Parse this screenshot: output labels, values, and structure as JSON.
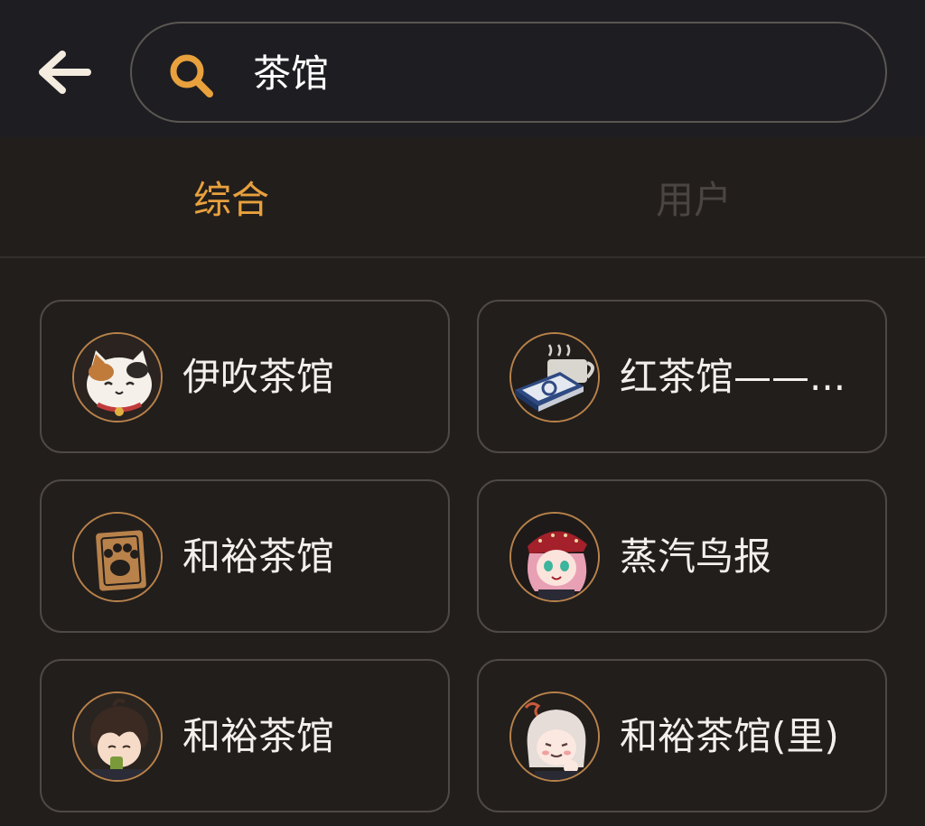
{
  "header": {
    "back_icon": "arrow-left-icon",
    "search_icon": "search-icon",
    "search_value": "茶馆",
    "accent_color": "#e8a13d"
  },
  "tabs": [
    {
      "label": "综合",
      "active": true
    },
    {
      "label": "用户",
      "active": false
    }
  ],
  "results": [
    {
      "title": "伊吹茶馆",
      "avatar": "lucky-cat-avatar"
    },
    {
      "title": "红茶馆——...",
      "avatar": "teacup-book-avatar"
    },
    {
      "title": "和裕茶馆",
      "avatar": "paw-card-avatar"
    },
    {
      "title": "蒸汽鸟报",
      "avatar": "pink-hair-girl-avatar"
    },
    {
      "title": "和裕茶馆",
      "avatar": "brown-hair-boy-avatar"
    },
    {
      "title": "和裕茶馆(里)",
      "avatar": "white-hair-girl-avatar"
    }
  ]
}
